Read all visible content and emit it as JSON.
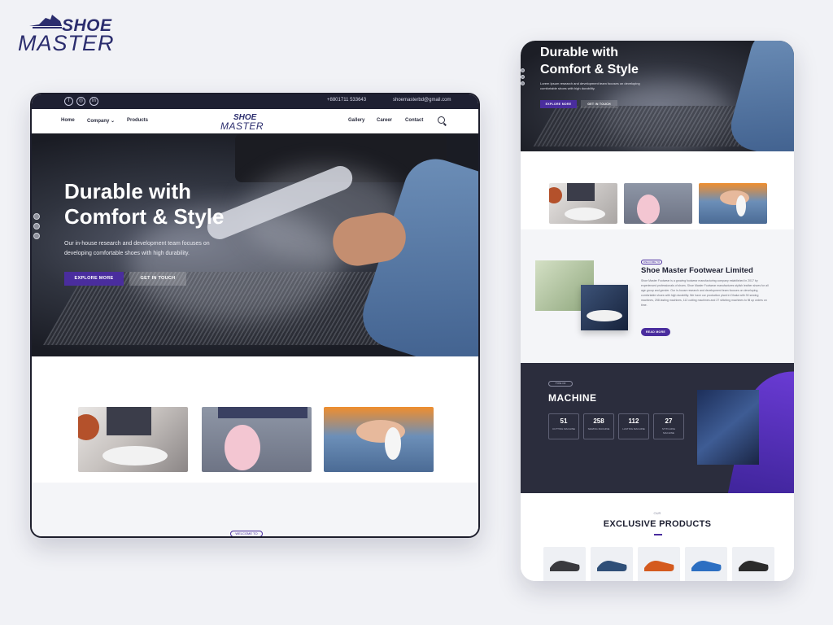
{
  "logo": {
    "line1": "SHOE",
    "line2": "MASTER"
  },
  "desktop": {
    "topbar": {
      "social": [
        "f",
        "◎",
        "in"
      ],
      "phone": "+8801711 533643",
      "email": "shoemasterbd@gmail.com"
    },
    "nav": {
      "home": "Home",
      "company": "Company ⌄",
      "products": "Products",
      "logo1": "SHOE",
      "logo2": "MASTER",
      "gallery": "Gallery",
      "career": "Career",
      "contact": "Contact"
    },
    "hero": {
      "title": "Durable with Comfort & Style",
      "text": "Our in-house research and development team focuses on developing comfortable shoes with high durability.",
      "btn_explore": "EXPLORE MORE",
      "btn_touch": "GET IN TOUCH"
    },
    "welcome_pill": "WELCOME TO"
  },
  "mobile": {
    "hero": {
      "title": "Durable with Comfort & Style",
      "text": "Lorem Ipsum research and development team focuses on developing comfortable shoes with high durability.",
      "btn_explore": "EXPLORE MORE",
      "btn_touch": "GET IN TOUCH"
    },
    "about": {
      "pill": "WELCOME TO",
      "title": "Shoe Master Footwear Limited",
      "text": "Shoe Master Footwear is a growing footwear manufacturing company established in 2017 by experienced professionals of shoes. Shoe Master Footwear manufactures stylish leather shoes for all age group and gender. Our in-house research and development team focuses on developing comfortable shoes with high durability. We have our production plant in Dhaka with 30 sewing machines, 258 lasting machines, 112 cutting machines and 27 stitching machines to fill up orders on time.",
      "button": "READ MORE"
    },
    "machine": {
      "pill": "TYPE OF",
      "title": "MACHINE",
      "stats": [
        {
          "num": "51",
          "label": "CUTTING MACHINE"
        },
        {
          "num": "258",
          "label": "SEWING MACHINE"
        },
        {
          "num": "112",
          "label": "LASTING MACHINE"
        },
        {
          "num": "27",
          "label": "STITCHING MACHINE"
        }
      ]
    },
    "products": {
      "kicker": "OUR",
      "title": "EXCLUSIVE PRODUCTS",
      "shoe_colors": [
        "#3a3a3e",
        "#2f4f78",
        "#d45a1e",
        "#2c6fc2",
        "#2b2b2b"
      ]
    }
  },
  "colors": {
    "accent": "#4a2d9e",
    "dark": "#1e2032"
  }
}
